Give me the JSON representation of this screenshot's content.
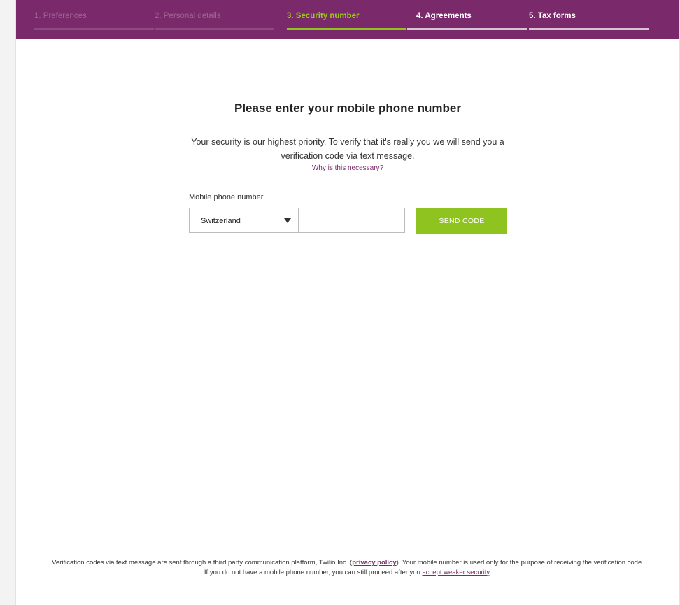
{
  "steps": [
    {
      "label": "1. Preferences",
      "state": "done"
    },
    {
      "label": "2. Personal details",
      "state": "done"
    },
    {
      "label": "3. Security number",
      "state": "active"
    },
    {
      "label": "4. Agreements",
      "state": "todo"
    },
    {
      "label": "5. Tax forms",
      "state": "todo"
    }
  ],
  "main": {
    "title": "Please enter your mobile phone number",
    "intro": "Your security is our highest priority. To verify that it's really you we will send you a verification code via text message.",
    "why_link": "Why is this necessary?",
    "phone_label": "Mobile phone number",
    "country_value": "Switzerland",
    "phone_value": "",
    "send_button": "SEND CODE"
  },
  "footer": {
    "line1_a": "Verification codes via text message are sent through a third party communication platform, Twilio Inc. (",
    "privacy_link": "privacy policy",
    "line1_b": "). Your mobile number is used only for the purpose of receiving the verification code.",
    "line2_a": "If you do not have a mobile phone number, you can still proceed after you ",
    "weaker_link": "accept weaker security",
    "line2_b": "."
  },
  "colors": {
    "brand_purple": "#7a2a6b",
    "accent_green": "#8fc31f"
  }
}
